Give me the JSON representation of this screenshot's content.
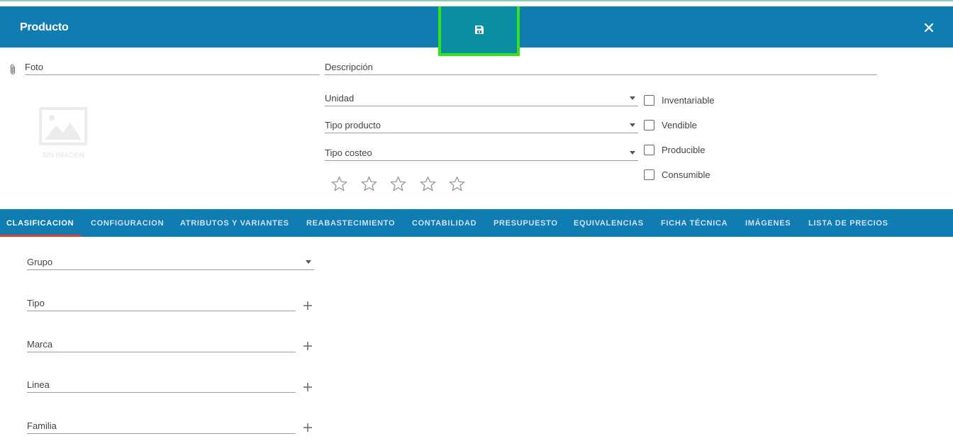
{
  "window": {
    "title": "Producto"
  },
  "header": {
    "save_icon": "save-icon",
    "close_icon": "close-icon"
  },
  "photo": {
    "label": "Foto",
    "placeholder_text": "SIN IMAGEN"
  },
  "form": {
    "description_label": "Descripción",
    "unidad_label": "Unidad",
    "tipo_producto_label": "Tipo producto",
    "tipo_costeo_label": "Tipo costeo"
  },
  "checks": [
    {
      "label": "Inventariable",
      "checked": false
    },
    {
      "label": "Vendible",
      "checked": false
    },
    {
      "label": "Producible",
      "checked": false
    },
    {
      "label": "Consumible",
      "checked": false
    }
  ],
  "rating": {
    "max": 5,
    "value": 0
  },
  "tabs": [
    {
      "label": "CLASIFICACION"
    },
    {
      "label": "CONFIGURACION"
    },
    {
      "label": "ATRIBUTOS Y VARIANTES"
    },
    {
      "label": "REABASTECIMIENTO"
    },
    {
      "label": "CONTABILIDAD"
    },
    {
      "label": "PRESUPUESTO"
    },
    {
      "label": "EQUIVALENCIAS"
    },
    {
      "label": "FICHA TÉCNICA"
    },
    {
      "label": "IMÁGENES"
    },
    {
      "label": "LISTA DE PRECIOS"
    }
  ],
  "active_tab": "CLASIFICACION",
  "clasificacion": {
    "grupo_label": "Grupo",
    "tipo_label": "Tipo",
    "marca_label": "Marca",
    "linea_label": "Linea",
    "familia_label": "Familia"
  },
  "colors": {
    "primary": "#0f7cb2",
    "save_bg": "#0a8fa0",
    "highlight": "#36e21a",
    "active_tab_underline": "#e53935"
  }
}
